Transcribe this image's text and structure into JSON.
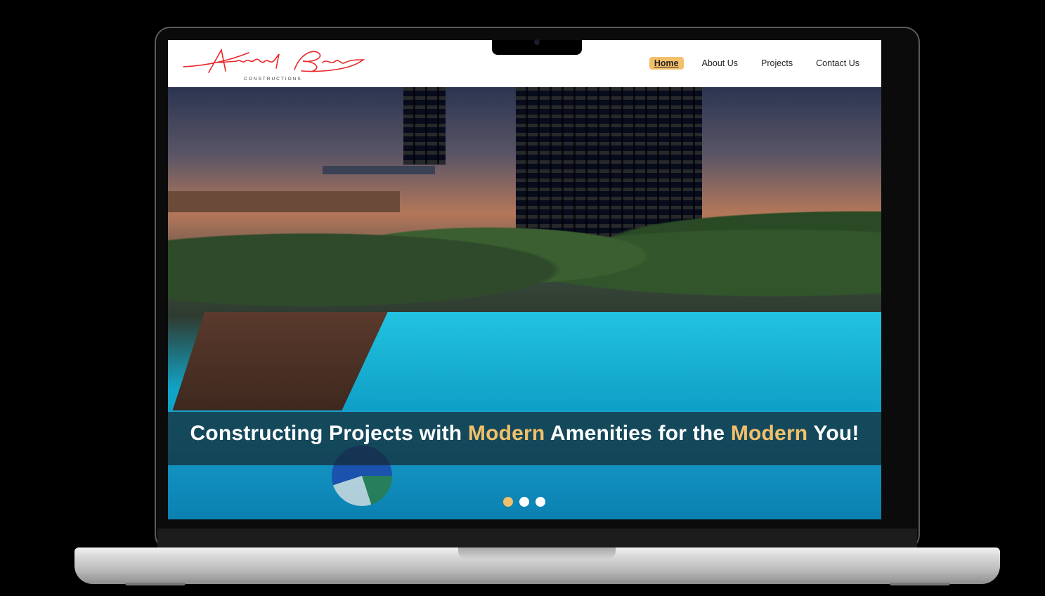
{
  "brand": {
    "signature": "Anand Bose",
    "sub": "CONSTRUCTIONS",
    "color": "#e8282b"
  },
  "nav": {
    "items": [
      {
        "label": "Home",
        "active": true
      },
      {
        "label": "About Us",
        "active": false
      },
      {
        "label": "Projects",
        "active": false
      },
      {
        "label": "Contact Us",
        "active": false
      }
    ],
    "accent": "#f3c06a"
  },
  "hero": {
    "tagline_parts": {
      "a": "Constructing Projects with ",
      "b": "Modern",
      "c": " Amenities for the ",
      "d": "Modern",
      "e": " You!"
    },
    "slides": 3,
    "active_slide": 1
  }
}
